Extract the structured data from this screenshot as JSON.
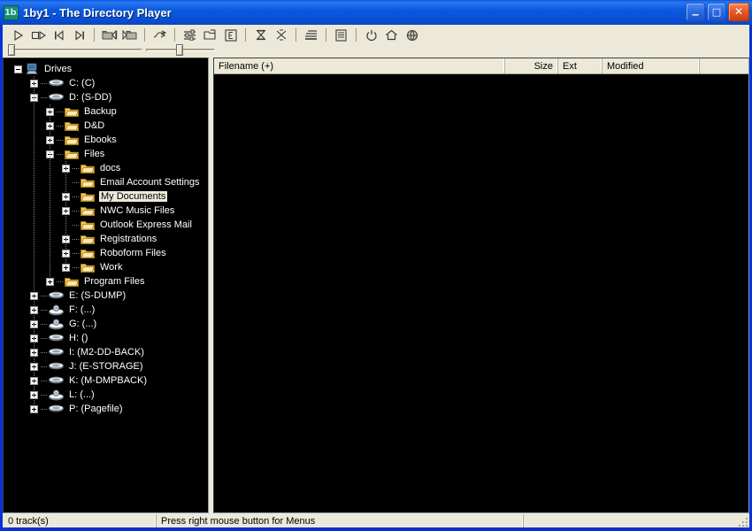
{
  "window": {
    "title": "1by1  -  The Directory Player",
    "icon": "app-icon",
    "icon_text": "1b1",
    "buttons": {
      "minimize": "_",
      "maximize": "□",
      "close": "✕"
    },
    "colors": {
      "titlebar": "#0a5ae0",
      "frame": "#0831d9",
      "face": "#ece9d8",
      "listbg": "#000000",
      "selection_bg": "#ece9d8"
    }
  },
  "toolbar": {
    "buttons": [
      {
        "name": "play-button",
        "icon": "play-icon",
        "label": "Play"
      },
      {
        "name": "play-pause-button",
        "icon": "play-pause-icon",
        "label": "Play / Pause"
      },
      {
        "name": "previous-track-button",
        "icon": "previous-track-icon",
        "label": "Previous Track"
      },
      {
        "name": "next-track-button",
        "icon": "next-track-icon",
        "label": "Next Track"
      },
      {
        "name": "previous-folder-button",
        "icon": "previous-folder-icon",
        "label": "Previous Folder"
      },
      {
        "name": "next-folder-button",
        "icon": "next-folder-icon",
        "label": "Next Folder"
      },
      {
        "name": "jump-button",
        "icon": "double-arrow-icon",
        "label": "Jump"
      },
      {
        "name": "equalizer-button",
        "icon": "equalizer-icon",
        "label": "Equalizer"
      },
      {
        "name": "folder-button",
        "icon": "folder-icon",
        "label": "Folder"
      },
      {
        "name": "tag-editor-button",
        "icon": "boxed-e-icon",
        "label": "Tag Editor"
      },
      {
        "name": "sleep-timer-button",
        "icon": "hourglass-icon",
        "label": "Sleep Timer"
      },
      {
        "name": "random-button",
        "icon": "shuffle-x-icon",
        "label": "Random"
      },
      {
        "name": "playlist-button",
        "icon": "playlist-lines-icon",
        "label": "Playlist"
      },
      {
        "name": "list-view-button",
        "icon": "list-view-icon",
        "label": "List View"
      },
      {
        "name": "power-button",
        "icon": "power-icon",
        "label": "Power"
      },
      {
        "name": "home-button",
        "icon": "home-icon",
        "label": "Home"
      },
      {
        "name": "globe-button",
        "icon": "globe-icon",
        "label": "Web"
      }
    ]
  },
  "sliders": {
    "position": {
      "name": "position-slider",
      "value": 0
    },
    "volume": {
      "name": "volume-slider",
      "value": 50
    }
  },
  "tree": {
    "root_label": "Drives",
    "items": [
      {
        "label": "Drives",
        "depth": 0,
        "icon": "computer-icon",
        "expander": "minus",
        "selected": false
      },
      {
        "label": "C: (C)",
        "depth": 1,
        "icon": "harddisk-icon",
        "expander": "plus",
        "selected": false
      },
      {
        "label": "D: (S-DD)",
        "depth": 1,
        "icon": "harddisk-icon",
        "expander": "minus",
        "selected": false
      },
      {
        "label": "Backup",
        "depth": 2,
        "icon": "folder-icon",
        "expander": "plus",
        "selected": false
      },
      {
        "label": "D&D",
        "depth": 2,
        "icon": "folder-icon",
        "expander": "plus",
        "selected": false
      },
      {
        "label": "Ebooks",
        "depth": 2,
        "icon": "folder-icon",
        "expander": "plus",
        "selected": false
      },
      {
        "label": "Files",
        "depth": 2,
        "icon": "folder-icon",
        "expander": "minus",
        "selected": false
      },
      {
        "label": "docs",
        "depth": 3,
        "icon": "folder-icon",
        "expander": "plus",
        "selected": false
      },
      {
        "label": "Email Account Settings",
        "depth": 3,
        "icon": "folder-icon",
        "expander": "none",
        "selected": false
      },
      {
        "label": "My Documents",
        "depth": 3,
        "icon": "folder-icon",
        "expander": "plus",
        "selected": true
      },
      {
        "label": "NWC Music Files",
        "depth": 3,
        "icon": "folder-icon",
        "expander": "plus",
        "selected": false
      },
      {
        "label": "Outlook Express Mail",
        "depth": 3,
        "icon": "folder-icon",
        "expander": "none",
        "selected": false
      },
      {
        "label": "Registrations",
        "depth": 3,
        "icon": "folder-icon",
        "expander": "plus",
        "selected": false
      },
      {
        "label": "Roboform Files",
        "depth": 3,
        "icon": "folder-icon",
        "expander": "plus",
        "selected": false
      },
      {
        "label": "Work",
        "depth": 3,
        "icon": "folder-icon",
        "expander": "plus",
        "selected": false
      },
      {
        "label": "Program Files",
        "depth": 2,
        "icon": "folder-icon",
        "expander": "plus",
        "selected": false
      },
      {
        "label": "E: (S-DUMP)",
        "depth": 1,
        "icon": "harddisk-icon",
        "expander": "plus",
        "selected": false
      },
      {
        "label": "F: (...)",
        "depth": 1,
        "icon": "cdrom-icon",
        "expander": "plus",
        "selected": false
      },
      {
        "label": "G: (...)",
        "depth": 1,
        "icon": "cdrom-icon",
        "expander": "plus",
        "selected": false
      },
      {
        "label": "H: ()",
        "depth": 1,
        "icon": "harddisk-icon",
        "expander": "plus",
        "selected": false
      },
      {
        "label": "I: (M2-DD-BACK)",
        "depth": 1,
        "icon": "harddisk-icon",
        "expander": "plus",
        "selected": false
      },
      {
        "label": "J: (E-STORAGE)",
        "depth": 1,
        "icon": "harddisk-icon",
        "expander": "plus",
        "selected": false
      },
      {
        "label": "K: (M-DMPBACK)",
        "depth": 1,
        "icon": "harddisk-icon",
        "expander": "plus",
        "selected": false
      },
      {
        "label": "L: (...)",
        "depth": 1,
        "icon": "cdrom-icon",
        "expander": "plus",
        "selected": false
      },
      {
        "label": "P: (Pagefile)",
        "depth": 1,
        "icon": "harddisk-icon",
        "expander": "plus",
        "selected": false
      }
    ]
  },
  "filelist": {
    "columns": [
      {
        "label": "Filename (+)",
        "key": "filename"
      },
      {
        "label": "Size",
        "key": "size"
      },
      {
        "label": "Ext",
        "key": "ext"
      },
      {
        "label": "Modified",
        "key": "modified"
      },
      {
        "label": "",
        "key": "spare"
      }
    ],
    "rows": []
  },
  "statusbar": {
    "tracks": "0 track(s)",
    "hint": "Press right mouse button for Menus",
    "spare": ""
  }
}
